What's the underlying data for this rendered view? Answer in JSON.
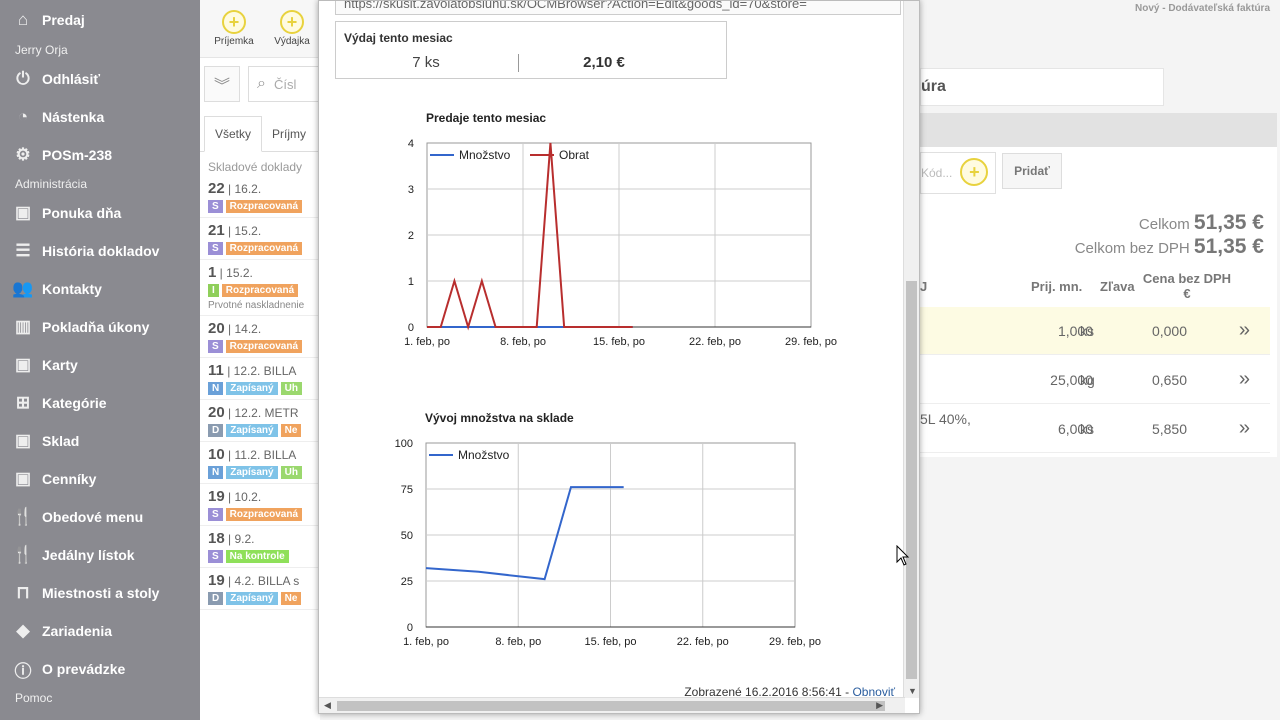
{
  "sidebar": {
    "top": {
      "label": "Predaj",
      "icon": "home-icon"
    },
    "user": "Jerry Orja",
    "items_a": [
      {
        "label": "Odhlásiť",
        "icon": "power-icon"
      },
      {
        "label": "Nástenka",
        "icon": "dashboard-icon"
      },
      {
        "label": "POSm-238",
        "icon": "gear-icon"
      }
    ],
    "section_admin": "Administrácia",
    "items_b": [
      {
        "label": "Ponuka dňa",
        "icon": "boxes-star-icon"
      },
      {
        "label": "História dokladov",
        "icon": "list-icon"
      },
      {
        "label": "Kontakty",
        "icon": "users-icon"
      },
      {
        "label": "Pokladňa úkony",
        "icon": "bar-chart-icon"
      },
      {
        "label": "Karty",
        "icon": "boxes-icon"
      },
      {
        "label": "Kategórie",
        "icon": "tree-icon"
      },
      {
        "label": "Sklad",
        "icon": "boxes-icon"
      },
      {
        "label": "Cenníky",
        "icon": "boxes-icon"
      },
      {
        "label": "Obedové menu",
        "icon": "cutlery-icon"
      },
      {
        "label": "Jedálny lístok",
        "icon": "cutlery-icon"
      },
      {
        "label": "Miestnosti a stoly",
        "icon": "table-icon"
      },
      {
        "label": "Zariadenia",
        "icon": "diamond-icon"
      },
      {
        "label": "O prevádzke",
        "icon": "info-icon"
      }
    ],
    "section_help": "Pomoc"
  },
  "docs": {
    "toolbar": {
      "prijemka": "Príjemka",
      "vydajka": "Výdajka"
    },
    "search_placeholder": "Čísl",
    "tabs": {
      "all": "Všetky",
      "prijmy": "Príjmy"
    },
    "section": "Skladové doklady",
    "list": [
      {
        "num": "22",
        "date": "16.2.",
        "type": "S",
        "type_color": "#9b8fd6",
        "status": "Rozpracovaná",
        "status_color": "#f0a35e",
        "extra": "",
        "extra_color": ""
      },
      {
        "num": "21",
        "date": "15.2.",
        "type": "S",
        "type_color": "#9b8fd6",
        "status": "Rozpracovaná",
        "status_color": "#f0a35e",
        "extra": "",
        "extra_color": ""
      },
      {
        "num": "1",
        "date": "15.2.",
        "type": "I",
        "type_color": "#8fcf5a",
        "status": "Rozpracovaná",
        "status_color": "#f0a35e",
        "extra": "",
        "extra_color": "",
        "note": "Prvotné naskladnenie"
      },
      {
        "num": "20",
        "date": "14.2.",
        "type": "S",
        "type_color": "#9b8fd6",
        "status": "Rozpracovaná",
        "status_color": "#f0a35e",
        "extra": "",
        "extra_color": ""
      },
      {
        "num": "11",
        "date": "12.2. BILLA",
        "type": "N",
        "type_color": "#6aa0d8",
        "status": "Zapísaný",
        "status_color": "#7fc3e8",
        "extra": "Uh",
        "extra_color": "#9bd86e"
      },
      {
        "num": "20",
        "date": "12.2. METR",
        "type": "D",
        "type_color": "#8a9bb0",
        "status": "Zapísaný",
        "status_color": "#7fc3e8",
        "extra": "Ne",
        "extra_color": "#f0a35e"
      },
      {
        "num": "10",
        "date": "11.2. BILLA",
        "type": "N",
        "type_color": "#6aa0d8",
        "status": "Zapísaný",
        "status_color": "#7fc3e8",
        "extra": "Uh",
        "extra_color": "#9bd86e"
      },
      {
        "num": "19",
        "date": "10.2.",
        "type": "S",
        "type_color": "#9b8fd6",
        "status": "Rozpracovaná",
        "status_color": "#f0a35e",
        "extra": "",
        "extra_color": ""
      },
      {
        "num": "18",
        "date": "9.2.",
        "type": "S",
        "type_color": "#9b8fd6",
        "status": "Na kontrole",
        "status_color": "#8fe05a",
        "extra": "",
        "extra_color": ""
      },
      {
        "num": "19",
        "date": "4.2. BILLA s",
        "type": "D",
        "type_color": "#8a9bb0",
        "status": "Zapísaný",
        "status_color": "#7fc3e8",
        "extra": "Ne",
        "extra_color": "#f0a35e"
      }
    ]
  },
  "invoice": {
    "top_label": "Nový - Dodávateľská faktúra",
    "title": "úra",
    "code_placeholder": "Kód...",
    "add_label": "Pridať",
    "total_label": "Celkom",
    "total_value": "51,35 €",
    "total_novat_label": "Celkom bez DPH",
    "total_novat_value": "51,35 €",
    "col_j": "J",
    "col_qty": "Prij. mn.",
    "col_discount": "Zľava",
    "col_price": "Cena bez DPH €",
    "rows": [
      {
        "desc": "",
        "qty": "1,000",
        "unit": "ks",
        "price": "0,000",
        "chev": "»"
      },
      {
        "desc": "",
        "qty": "25,000",
        "unit": "kg",
        "price": "0,650",
        "chev": "»"
      },
      {
        "desc": "5L 40%,",
        "qty": "6,000",
        "unit": "ks",
        "price": "5,850",
        "chev": "»"
      }
    ]
  },
  "popup": {
    "url": "https://skusit.zavolatobsluhu.sk/OCMBrowser?Action=Edit&goods_id=70&store=",
    "stat_title": "Výdaj tento mesiac",
    "stat_qty": "7 ks",
    "stat_value": "2,10 €",
    "footer_text": "Zobrazené 16.2.2016 8:56:41 - ",
    "footer_link": "Obnoviť"
  },
  "chart_data": [
    {
      "type": "line",
      "title": "Predaje tento mesiac",
      "x": [
        "1. feb, po",
        "2. feb",
        "3. feb",
        "4. feb",
        "5. feb",
        "6. feb",
        "7. feb",
        "8. feb, po",
        "9. feb",
        "10. feb",
        "11. feb",
        "12. feb",
        "13. feb",
        "14. feb",
        "15. feb, po",
        "16. feb"
      ],
      "x_tick_labels": [
        "1. feb, po",
        "8. feb, po",
        "15. feb, po",
        "22. feb, po",
        "29. feb, po"
      ],
      "series": [
        {
          "name": "Množstvo",
          "color": "#3366cc",
          "values": [
            0,
            0,
            0,
            0,
            0,
            0,
            0,
            0,
            0,
            0,
            0,
            0,
            0,
            0,
            0,
            0
          ]
        },
        {
          "name": "Obrat",
          "color": "#b82e2e",
          "values": [
            0,
            0,
            1,
            0,
            1,
            0,
            0,
            0,
            0,
            4,
            0,
            0,
            0,
            0,
            0,
            0
          ]
        }
      ],
      "ylim": [
        0,
        4
      ],
      "y_ticks": [
        0,
        1,
        2,
        3,
        4
      ],
      "grid": true,
      "legend": "top-left"
    },
    {
      "type": "line",
      "title": "Vývoj množstva na sklade",
      "x": [
        "1. feb, po",
        "5. feb",
        "10. feb",
        "12. feb",
        "16. feb"
      ],
      "x_tick_labels": [
        "1. feb, po",
        "8. feb, po",
        "15. feb, po",
        "22. feb, po",
        "29. feb, po"
      ],
      "series": [
        {
          "name": "Množstvo",
          "color": "#3366cc",
          "values": [
            32,
            30,
            26,
            76,
            76
          ],
          "x_days": [
            1,
            5,
            10,
            12,
            16
          ]
        }
      ],
      "ylim": [
        0,
        100
      ],
      "y_ticks": [
        0,
        25,
        50,
        75,
        100
      ],
      "grid": true,
      "legend": "top-left"
    }
  ]
}
